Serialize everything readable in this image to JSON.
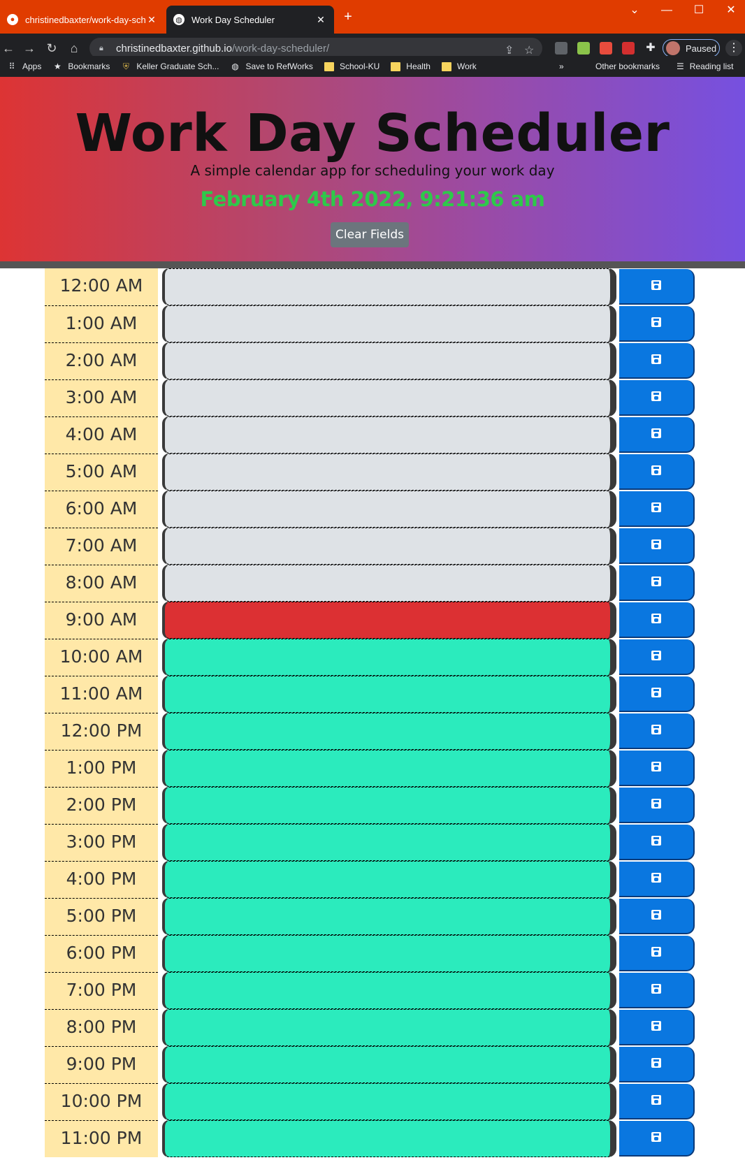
{
  "browser": {
    "tabs": [
      {
        "title": "christinedbaxter/work-day-sched",
        "icon": "github-icon"
      },
      {
        "title": "Work Day Scheduler",
        "icon": "globe-icon"
      }
    ],
    "url_host": "christinedbaxter.github.io",
    "url_path": "/work-day-scheduler/",
    "profile_status": "Paused",
    "bookmarks": [
      {
        "label": "Apps",
        "icon": "apps-grid-icon"
      },
      {
        "label": "Bookmarks",
        "icon": "star-icon"
      },
      {
        "label": "Keller Graduate Sch...",
        "icon": "shield-icon"
      },
      {
        "label": "Save to RefWorks",
        "icon": "globe-icon"
      },
      {
        "label": "School-KU",
        "icon": "folder-icon"
      },
      {
        "label": "Health",
        "icon": "folder-icon"
      },
      {
        "label": "Work",
        "icon": "folder-icon"
      }
    ],
    "overflow": "»",
    "other_bookmarks": "Other bookmarks",
    "reading_list": "Reading list"
  },
  "header": {
    "title": "Work Day Scheduler",
    "subtitle": "A simple calendar app for scheduling your work day",
    "current_time": "February 4th 2022, 9:21:36 am",
    "clear_label": "Clear Fields"
  },
  "colors": {
    "past": "#dee2e6",
    "present": "#dc3033",
    "future": "#2bebbd",
    "hour_bg": "#ffe8a8",
    "save": "#0a77e0"
  },
  "hours": [
    {
      "label": "12:00 AM",
      "state": "past",
      "text": ""
    },
    {
      "label": "1:00 AM",
      "state": "past",
      "text": ""
    },
    {
      "label": "2:00 AM",
      "state": "past",
      "text": ""
    },
    {
      "label": "3:00 AM",
      "state": "past",
      "text": ""
    },
    {
      "label": "4:00 AM",
      "state": "past",
      "text": ""
    },
    {
      "label": "5:00 AM",
      "state": "past",
      "text": ""
    },
    {
      "label": "6:00 AM",
      "state": "past",
      "text": ""
    },
    {
      "label": "7:00 AM",
      "state": "past",
      "text": ""
    },
    {
      "label": "8:00 AM",
      "state": "past",
      "text": ""
    },
    {
      "label": "9:00 AM",
      "state": "present",
      "text": ""
    },
    {
      "label": "10:00 AM",
      "state": "future",
      "text": ""
    },
    {
      "label": "11:00 AM",
      "state": "future",
      "text": ""
    },
    {
      "label": "12:00 PM",
      "state": "future",
      "text": ""
    },
    {
      "label": "1:00 PM",
      "state": "future",
      "text": ""
    },
    {
      "label": "2:00 PM",
      "state": "future",
      "text": ""
    },
    {
      "label": "3:00 PM",
      "state": "future",
      "text": ""
    },
    {
      "label": "4:00 PM",
      "state": "future",
      "text": ""
    },
    {
      "label": "5:00 PM",
      "state": "future",
      "text": ""
    },
    {
      "label": "6:00 PM",
      "state": "future",
      "text": ""
    },
    {
      "label": "7:00 PM",
      "state": "future",
      "text": ""
    },
    {
      "label": "8:00 PM",
      "state": "future",
      "text": ""
    },
    {
      "label": "9:00 PM",
      "state": "future",
      "text": ""
    },
    {
      "label": "10:00 PM",
      "state": "future",
      "text": ""
    },
    {
      "label": "11:00 PM",
      "state": "future",
      "text": ""
    }
  ]
}
